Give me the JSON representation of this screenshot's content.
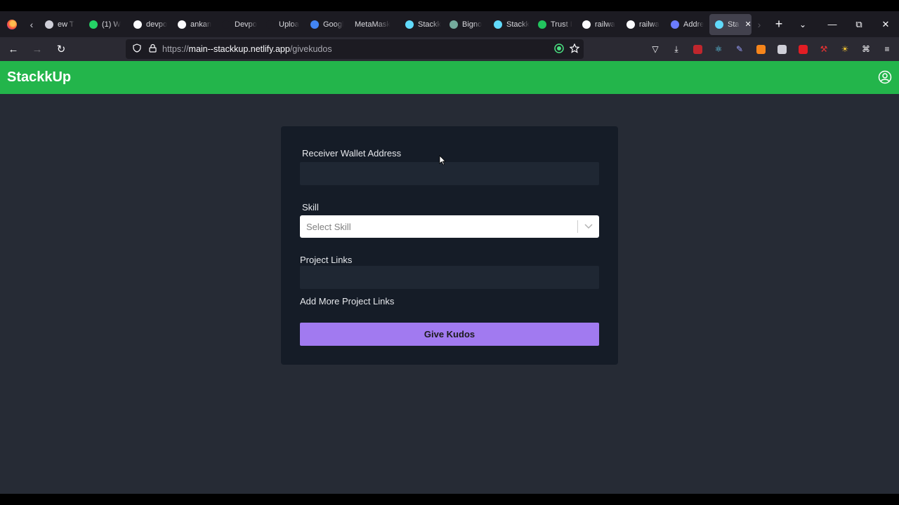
{
  "browser": {
    "tabs": [
      {
        "label": "ew T",
        "favicon": "tab-icon",
        "color": "#cfcfd8"
      },
      {
        "label": "(1) W",
        "favicon": "whatsapp-icon",
        "color": "#25d366"
      },
      {
        "label": "devpo",
        "favicon": "github-icon",
        "color": "#fbfbfe"
      },
      {
        "label": "ankan",
        "favicon": "github-icon",
        "color": "#fbfbfe"
      },
      {
        "label": "Devpo",
        "favicon": "devpost-icon",
        "color": "#1c1b22"
      },
      {
        "label": "Uploa",
        "favicon": "devpost-icon",
        "color": "#1c1b22"
      },
      {
        "label": "Googl",
        "favicon": "google-icon",
        "color": "#4285f4"
      },
      {
        "label": "MetaMask",
        "favicon": "",
        "color": ""
      },
      {
        "label": "Stackk",
        "favicon": "react-icon",
        "color": "#61dafb"
      },
      {
        "label": "Bigno",
        "favicon": "openai-icon",
        "color": "#74aa9c"
      },
      {
        "label": "Stackk",
        "favicon": "react-icon",
        "color": "#61dafb"
      },
      {
        "label": "Trust I",
        "favicon": "trust-icon",
        "color": "#22c55e"
      },
      {
        "label": "railwa",
        "favicon": "google-icon",
        "color": "#fbfbfe"
      },
      {
        "label": "railwa",
        "favicon": "google-icon",
        "color": "#fbfbfe"
      },
      {
        "label": "Addre",
        "favicon": "cube-icon",
        "color": "#6b7cff"
      },
      {
        "label": "Sta",
        "favicon": "react-icon",
        "color": "#61dafb",
        "active": true
      }
    ],
    "url_prefix": "https://",
    "url_host": "main--stackkup.netlify.app",
    "url_path": "/givekudos"
  },
  "app": {
    "brand": "StackkUp",
    "header_color": "#23b54b",
    "accent_color": "#a17af0"
  },
  "form": {
    "receiver_label": "Receiver Wallet Address",
    "receiver_value": "",
    "skill_label": "Skill",
    "skill_placeholder": "Select Skill",
    "project_links_label": "Project Links",
    "project_links_value": "",
    "add_more_label": "Add More Project Links",
    "submit_label": "Give Kudos"
  }
}
